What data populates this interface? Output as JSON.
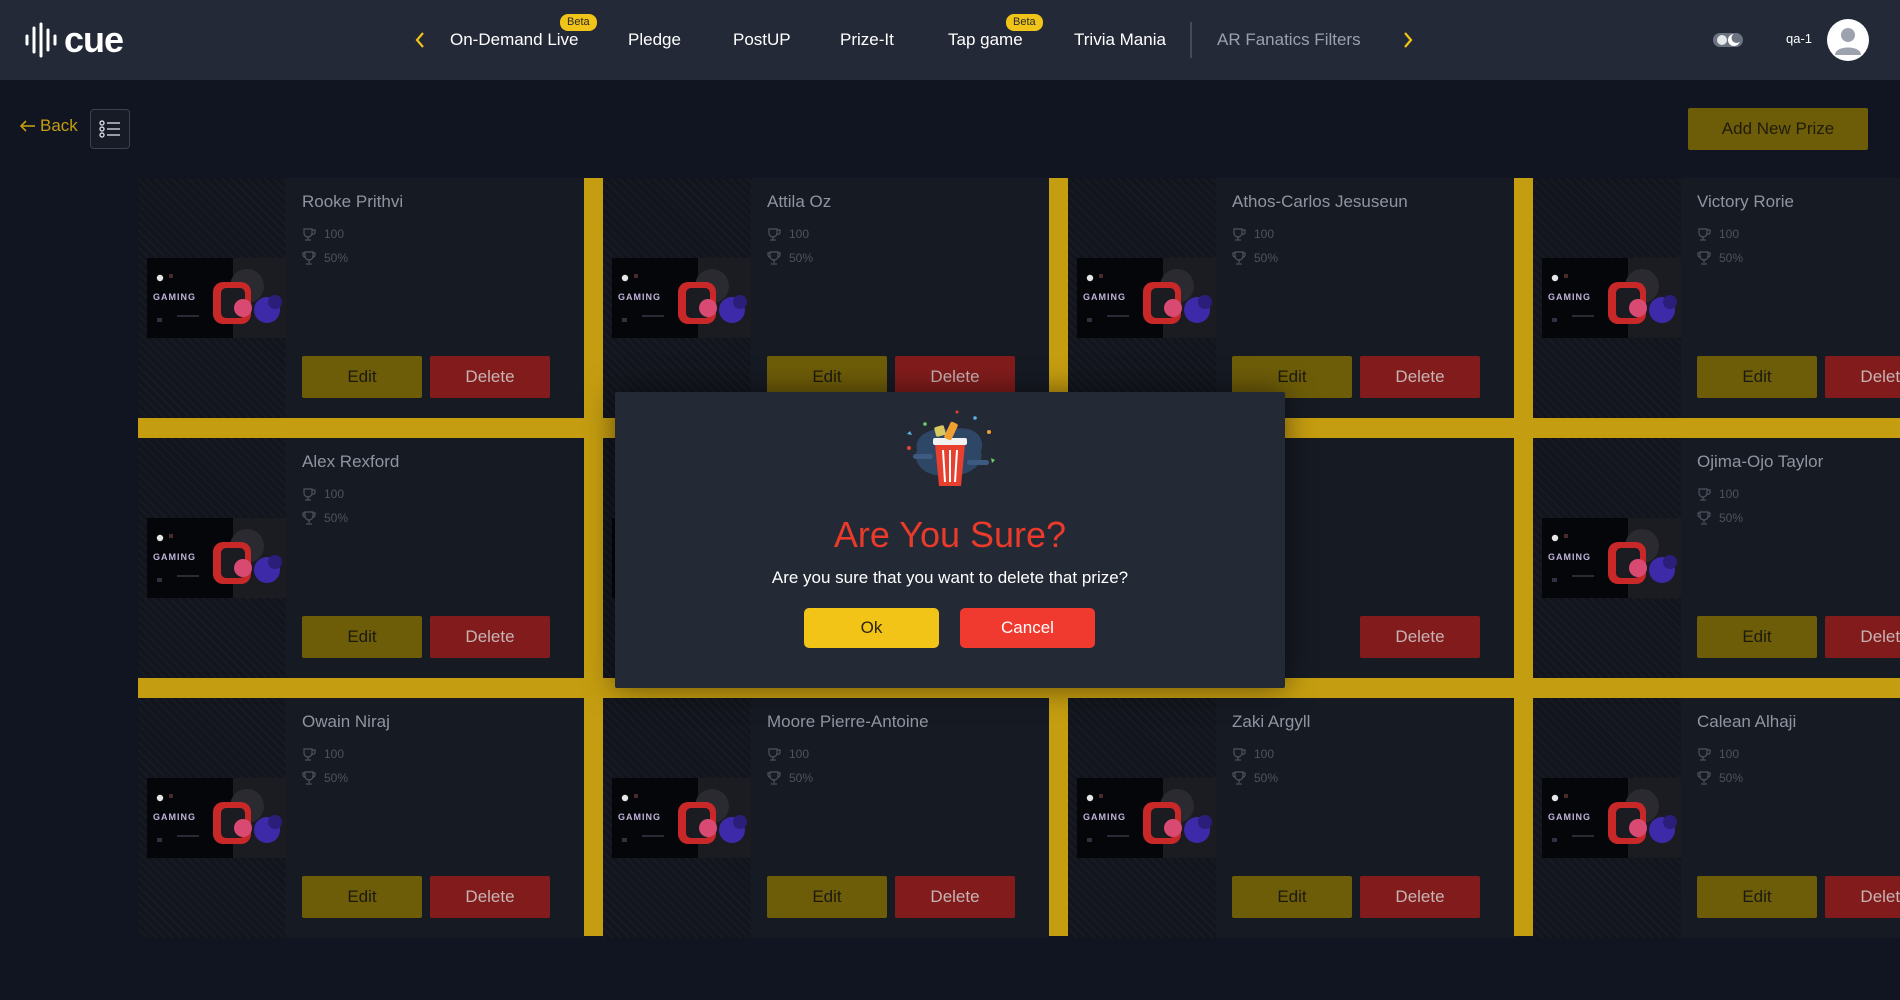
{
  "header": {
    "logo_text": "cue",
    "nav": [
      {
        "label": "On-Demand Live",
        "badge": "Beta"
      },
      {
        "label": "Pledge",
        "badge": ""
      },
      {
        "label": "PostUP",
        "badge": ""
      },
      {
        "label": "Prize-It",
        "badge": ""
      },
      {
        "label": "Tap game",
        "badge": "Beta"
      },
      {
        "label": "Trivia Mania",
        "badge": ""
      },
      {
        "label": "AR Fanatics Filters",
        "badge": ""
      }
    ],
    "user_name": "qa-1"
  },
  "toolbar": {
    "back_label": "Back",
    "add_label": "Add New Prize"
  },
  "cards": [
    {
      "name": "Rooke Prithvi",
      "stat1": "100",
      "stat2": "50%",
      "edit": "Edit",
      "delete": "Delete"
    },
    {
      "name": "Attila Oz",
      "stat1": "100",
      "stat2": "50%",
      "edit": "Edit",
      "delete": "Delete"
    },
    {
      "name": "Athos-Carlos Jesuseun",
      "stat1": "100",
      "stat2": "50%",
      "edit": "Edit",
      "delete": "Delete"
    },
    {
      "name": "Victory Rorie",
      "stat1": "100",
      "stat2": "50%",
      "edit": "Edit",
      "delete": "Delete"
    },
    {
      "name": "Alex Rexford",
      "stat1": "100",
      "stat2": "50%",
      "edit": "Edit",
      "delete": "Delete"
    },
    {
      "name": "",
      "stat1": "",
      "stat2": "",
      "edit": "",
      "delete": ""
    },
    {
      "name": "",
      "stat1": "",
      "stat2": "",
      "edit": "",
      "delete": "Delete"
    },
    {
      "name": "Ojima-Ojo Taylor",
      "stat1": "100",
      "stat2": "50%",
      "edit": "Edit",
      "delete": "Delete"
    },
    {
      "name": "Owain Niraj",
      "stat1": "100",
      "stat2": "50%",
      "edit": "Edit",
      "delete": "Delete"
    },
    {
      "name": "Moore Pierre-Antoine",
      "stat1": "100",
      "stat2": "50%",
      "edit": "Edit",
      "delete": "Delete"
    },
    {
      "name": "Zaki Argyll",
      "stat1": "100",
      "stat2": "50%",
      "edit": "Edit",
      "delete": "Delete"
    },
    {
      "name": "Calean Alhaji",
      "stat1": "100",
      "stat2": "50%",
      "edit": "Edit",
      "delete": "Delete"
    }
  ],
  "card_image_text": "GAMING",
  "modal": {
    "title": "Are You Sure?",
    "text": "Are you sure that you want to delete that prize?",
    "ok_label": "Ok",
    "cancel_label": "Cancel"
  },
  "colors": {
    "background": "#101521",
    "topbar": "#232936",
    "accent_gold": "#f2c418",
    "danger_red": "#f03a30"
  }
}
